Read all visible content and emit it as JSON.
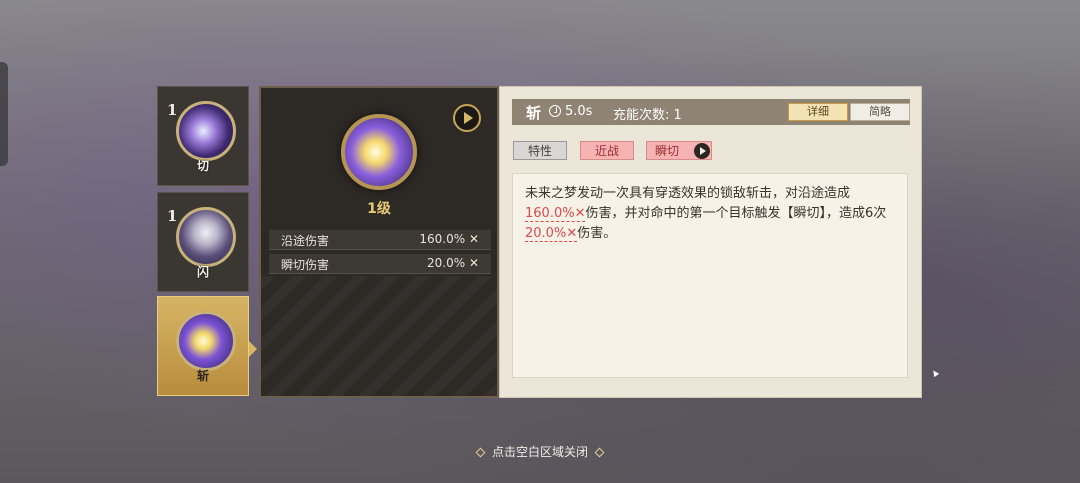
{
  "skills": [
    {
      "level": "1",
      "name": "切",
      "icon": "slash-skill-icon",
      "active": false
    },
    {
      "level": "1",
      "name": "闪",
      "icon": "character-portrait-icon",
      "active": false
    },
    {
      "level": "",
      "name": "斩",
      "icon": "lightning-slash-icon",
      "active": true
    }
  ],
  "selected": {
    "level_label": "1级",
    "stats": [
      {
        "label": "沿途伤害",
        "value": "160.0%"
      },
      {
        "label": "瞬切伤害",
        "value": "20.0%"
      }
    ]
  },
  "detail": {
    "name": "斩",
    "cooldown": "5.0s",
    "charges": "充能次数: 1",
    "toggle_detail": "详细",
    "toggle_brief": "简略",
    "tags": [
      "特性",
      "近战",
      "瞬切"
    ],
    "desc_1": "未来之梦发动一次具有穿透效果的锁敌斩击，对沿途造成",
    "desc_v1": "160.0%",
    "desc_2": "伤害，并对命中的第一个目标触发【瞬切】，造成6次",
    "desc_v2": "20.0%",
    "desc_3": "伤害。"
  },
  "hint": "点击空白区域关闭",
  "colors": {
    "accent": "#d7b666",
    "highlight": "#d84b4b"
  }
}
